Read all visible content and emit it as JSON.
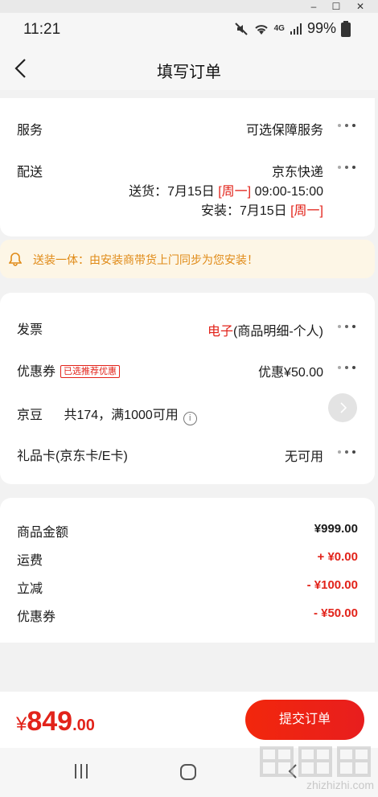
{
  "status_bar": {
    "time": "11:21",
    "battery": "99%",
    "net": "4G"
  },
  "header": {
    "title": "填写订单"
  },
  "delivery_card": {
    "service_label": "服务",
    "service_value": "可选保障服务",
    "shipping_label": "配送",
    "shipping_value": "京东快递",
    "delivery_prefix": "送货：7月15日",
    "delivery_day": "[周一]",
    "delivery_time": "09:00-15:00",
    "install_prefix": "安装：7月15日",
    "install_day": "[周一]"
  },
  "banner": {
    "text": "送装一体：由安装商带货上门同步为您安装！"
  },
  "payment_card": {
    "invoice_label": "发票",
    "invoice_type": "电子",
    "invoice_detail": "(商品明细-个人)",
    "coupon_label": "优惠券",
    "coupon_tag": "已选推荐优惠",
    "coupon_value": "优惠¥50.00",
    "jd_beans_label": "京豆",
    "jd_beans_value": "共174，满1000可用",
    "gift_card_label": "礼品卡(京东卡/E卡)",
    "gift_card_value": "无可用"
  },
  "summary": {
    "goods_label": "商品金额",
    "goods_value": "¥999.00",
    "freight_label": "运费",
    "freight_value": "+ ¥0.00",
    "discount_label": "立减",
    "discount_value": "- ¥100.00",
    "coupon_label": "优惠券",
    "coupon_value": "- ¥50.00"
  },
  "bottom": {
    "currency": "¥",
    "total_int": "849",
    "total_dec": ".00",
    "submit_label": "提交订单"
  },
  "watermark": {
    "site": "zhizhizhi.com"
  },
  "colors": {
    "accent": "#e2231a",
    "banner_text": "#e08a16",
    "banner_bg": "#fdf6e6"
  }
}
